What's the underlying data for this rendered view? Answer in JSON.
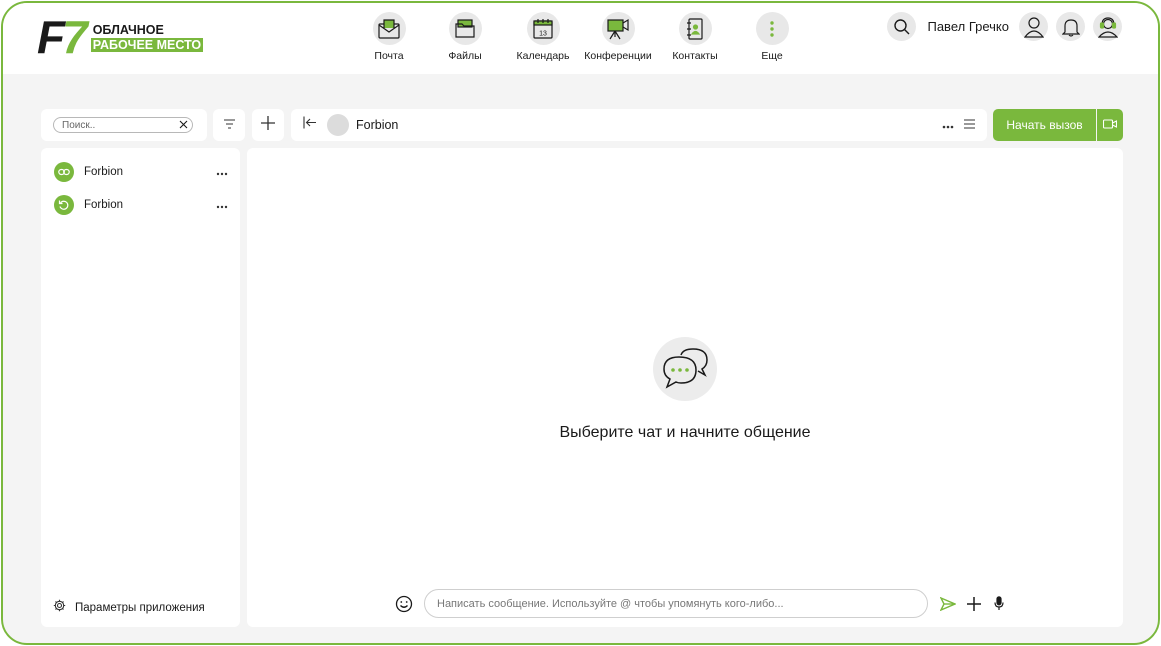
{
  "brand": {
    "mark_f": "F",
    "mark_seven": "7",
    "line1": "ОБЛАЧНОЕ",
    "line2": "РАБОЧЕЕ МЕСТО",
    "accent_color": "#7ab83d"
  },
  "nav": {
    "items": [
      {
        "label": "Почта",
        "icon": "mail-icon"
      },
      {
        "label": "Файлы",
        "icon": "files-icon"
      },
      {
        "label": "Календарь",
        "icon": "calendar-icon",
        "day": "13"
      },
      {
        "label": "Конференции",
        "icon": "conference-icon"
      },
      {
        "label": "Контакты",
        "icon": "contacts-icon"
      },
      {
        "label": "Еще",
        "icon": "more-vertical-icon"
      }
    ]
  },
  "header": {
    "user_name": "Павел Гречко",
    "icons": [
      "search-icon",
      "user-profile-icon",
      "bell-icon",
      "support-icon"
    ]
  },
  "toolbar": {
    "search_placeholder": "Поиск..",
    "filter_icon": "filter-icon",
    "add_icon": "plus-icon"
  },
  "chat_header": {
    "back_icon": "collapse-left-icon",
    "title": "Forbion",
    "call_label": "Начать вызов",
    "video_icon": "video-camera-icon"
  },
  "sidebar": {
    "items": [
      {
        "name": "Forbion",
        "icon": "link-icon"
      },
      {
        "name": "Forbion",
        "icon": "refresh-icon"
      }
    ],
    "settings_label": "Параметры приложения"
  },
  "main": {
    "empty_text": "Выберите чат и начните общение"
  },
  "composer": {
    "placeholder": "Написать сообщение. Используйте @ чтобы упомянуть кого-либо...",
    "icons": [
      "emoji-icon",
      "send-icon",
      "attach-plus-icon",
      "microphone-icon"
    ]
  }
}
